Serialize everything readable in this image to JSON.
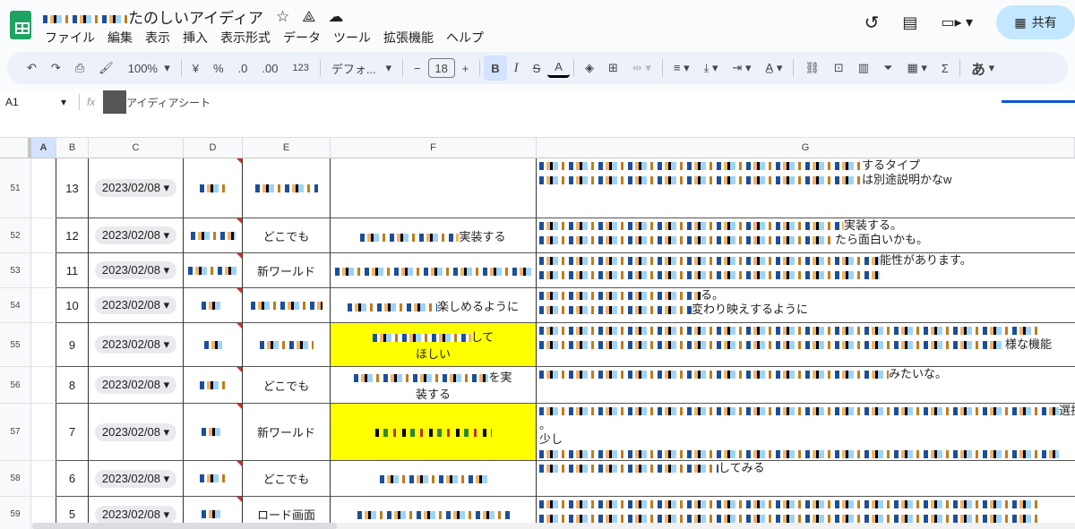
{
  "app": {
    "title": "たのしいアイディア",
    "menu": [
      "ファイル",
      "編集",
      "表示",
      "挿入",
      "表示形式",
      "データ",
      "ツール",
      "拡張機能",
      "ヘルプ"
    ],
    "share": "共有",
    "accent": "#0b57d0",
    "share_bg": "#c2e7ff"
  },
  "toolbar": {
    "zoom": "100%",
    "currency": "¥",
    "percent": "%",
    "dec_down": ".0",
    "dec_up": ".00",
    "num_format": "123",
    "font": "デフォ...",
    "font_size": "18",
    "bold": "B",
    "italic": "I",
    "text_color": "A",
    "ime": "あ"
  },
  "formula_bar": {
    "cell_ref": "A1",
    "fx": "fx",
    "value": "アイディアシート"
  },
  "columns": [
    "A",
    "B",
    "C",
    "D",
    "E",
    "F",
    "G"
  ],
  "rows": [
    {
      "n": "51",
      "b": "13",
      "c": "2023/02/08",
      "e": [
        ""
      ],
      "f": [],
      "g": [
        "するタイプ",
        "",
        "は別途説明かなw"
      ]
    },
    {
      "n": "52",
      "b": "12",
      "c": "2023/02/08",
      "e": [
        "どこでも"
      ],
      "f": [
        "実装する"
      ],
      "g": [
        "実装する。",
        "たら面白いかも。"
      ]
    },
    {
      "n": "53",
      "b": "11",
      "c": "2023/02/08",
      "e": [
        "新ワールド"
      ],
      "f": [
        ""
      ],
      "g": [
        "能性があります。",
        ""
      ]
    },
    {
      "n": "54",
      "b": "10",
      "c": "2023/02/08",
      "e": [
        ""
      ],
      "f": [
        "楽しめるように"
      ],
      "g": [
        "る。",
        "変わり映えするように"
      ]
    },
    {
      "n": "55",
      "b": "9",
      "c": "2023/02/08",
      "e": [
        ""
      ],
      "f": [
        "して",
        "ほしい"
      ],
      "g": [
        "",
        "様な機能",
        ""
      ],
      "f_highlight": "#ffff00"
    },
    {
      "n": "56",
      "b": "8",
      "c": "2023/02/08",
      "e": [
        "どこでも"
      ],
      "f": [
        "を実",
        "装する"
      ],
      "g": [
        "みたいな。"
      ]
    },
    {
      "n": "57",
      "b": "7",
      "c": "2023/02/08",
      "e": [
        "新ワールド"
      ],
      "f": [
        ""
      ],
      "g": [
        "選択",
        "。",
        "少し",
        ""
      ],
      "f_highlight": "#ffff00"
    },
    {
      "n": "58",
      "b": "6",
      "c": "2023/02/08",
      "e": [
        "どこでも"
      ],
      "f": [
        ""
      ],
      "g": [
        "してみる"
      ]
    },
    {
      "n": "59",
      "b": "5",
      "c": "2023/02/08",
      "e": [
        "ロード画面"
      ],
      "f": [
        ""
      ],
      "g": [
        "",
        ""
      ]
    }
  ]
}
